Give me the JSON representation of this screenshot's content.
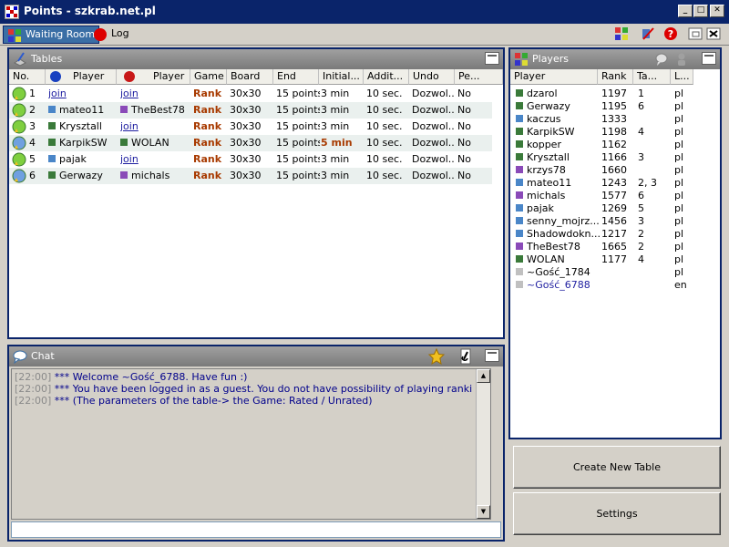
{
  "window": {
    "title": "Points - szkrab.net.pl"
  },
  "tabs": [
    {
      "label": "Waiting Room",
      "icon": "waiting-room-icon"
    },
    {
      "label": "Log",
      "icon": "log-icon"
    }
  ],
  "tables_panel": {
    "title": "Tables",
    "columns": [
      "No.",
      "Player",
      "Player",
      "Game",
      "Board",
      "End",
      "Initial...",
      "Addit...",
      "Undo",
      "Pe..."
    ],
    "rows": [
      {
        "no": "1",
        "p1": "join",
        "p2": "join",
        "game": "Rank",
        "board": "30x30",
        "end": "15 points",
        "initial": "3 min",
        "addit": "10 sec.",
        "undo": "Dozwol...",
        "pe": "No"
      },
      {
        "no": "2",
        "p1": "mateo11",
        "p2": "TheBest78",
        "game": "Rank",
        "board": "30x30",
        "end": "15 points",
        "initial": "3 min",
        "addit": "10 sec.",
        "undo": "Dozwol...",
        "pe": "No"
      },
      {
        "no": "3",
        "p1": "Krysztall",
        "p2": "join",
        "game": "Rank",
        "board": "30x30",
        "end": "15 points",
        "initial": "3 min",
        "addit": "10 sec.",
        "undo": "Dozwol...",
        "pe": "No"
      },
      {
        "no": "4",
        "p1": "KarpikSW",
        "p2": "WOLAN",
        "game": "Rank",
        "board": "30x30",
        "end": "15 points",
        "initial": "5 min",
        "addit": "10 sec.",
        "undo": "Dozwol...",
        "pe": "No"
      },
      {
        "no": "5",
        "p1": "pajak",
        "p2": "join",
        "game": "Rank",
        "board": "30x30",
        "end": "15 points",
        "initial": "3 min",
        "addit": "10 sec.",
        "undo": "Dozwol...",
        "pe": "No"
      },
      {
        "no": "6",
        "p1": "Gerwazy",
        "p2": "michals",
        "game": "Rank",
        "board": "30x30",
        "end": "15 points",
        "initial": "3 min",
        "addit": "10 sec.",
        "undo": "Dozwol...",
        "pe": "No"
      }
    ]
  },
  "players_panel": {
    "title": "Players",
    "columns": [
      "Player",
      "Rank",
      "Ta...",
      "L..."
    ],
    "rows": [
      {
        "name": "dzarol",
        "rank": "1197",
        "table": "1",
        "lang": "pl",
        "color": "#3a7a3a"
      },
      {
        "name": "Gerwazy",
        "rank": "1195",
        "table": "6",
        "lang": "pl",
        "color": "#3a7a3a"
      },
      {
        "name": "kaczus",
        "rank": "1333",
        "table": "",
        "lang": "pl",
        "color": "#4a86c8"
      },
      {
        "name": "KarpikSW",
        "rank": "1198",
        "table": "4",
        "lang": "pl",
        "color": "#3a7a3a"
      },
      {
        "name": "kopper",
        "rank": "1162",
        "table": "",
        "lang": "pl",
        "color": "#3a7a3a"
      },
      {
        "name": "Krysztall",
        "rank": "1166",
        "table": "3",
        "lang": "pl",
        "color": "#3a7a3a"
      },
      {
        "name": "krzys78",
        "rank": "1660",
        "table": "",
        "lang": "pl",
        "color": "#8a4ab8"
      },
      {
        "name": "mateo11",
        "rank": "1243",
        "table": "2, 3",
        "lang": "pl",
        "color": "#4a86c8"
      },
      {
        "name": "michals",
        "rank": "1577",
        "table": "6",
        "lang": "pl",
        "color": "#8a4ab8"
      },
      {
        "name": "pajak",
        "rank": "1269",
        "table": "5",
        "lang": "pl",
        "color": "#4a86c8"
      },
      {
        "name": "senny_mojrz...",
        "rank": "1456",
        "table": "3",
        "lang": "pl",
        "color": "#4a86c8"
      },
      {
        "name": "Shadowdokn...",
        "rank": "1217",
        "table": "2",
        "lang": "pl",
        "color": "#4a86c8"
      },
      {
        "name": "TheBest78",
        "rank": "1665",
        "table": "2",
        "lang": "pl",
        "color": "#8a4ab8"
      },
      {
        "name": "WOLAN",
        "rank": "1177",
        "table": "4",
        "lang": "pl",
        "color": "#3a7a3a"
      },
      {
        "name": "~Gość_1784",
        "rank": "",
        "table": "",
        "lang": "pl",
        "color": "#c0c0c0"
      },
      {
        "name": "~Gość_6788",
        "rank": "",
        "table": "",
        "lang": "en",
        "color": "#c0c0c0"
      }
    ]
  },
  "chat_panel": {
    "title": "Chat",
    "messages": [
      {
        "time": "[22:00]",
        "text": "*** Welcome ~Gość_6788. Have fun :)"
      },
      {
        "time": "[22:00]",
        "text": "*** You have been logged in as a guest. You do not have possibility of playing ranking games..."
      },
      {
        "time": "[22:00]",
        "text": "*** (The parameters of the table-> the Game: Rated / Unrated)"
      }
    ],
    "input_value": ""
  },
  "buttons": {
    "create_table": "Create New Table",
    "settings": "Settings"
  },
  "colors": {
    "title_bar": "#0a246a",
    "rank_text": "#a83a00",
    "chat_text": "#00008b",
    "link": "#1e1ea0"
  }
}
